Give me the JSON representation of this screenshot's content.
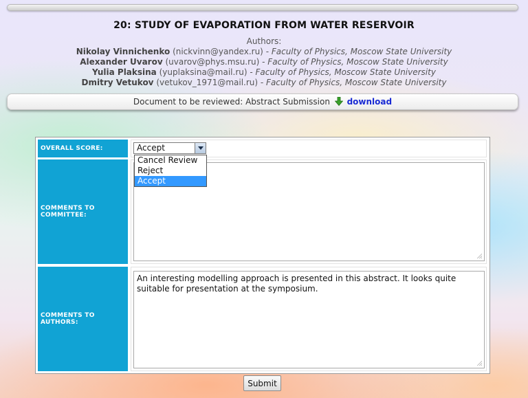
{
  "paper": {
    "title": "20: STUDY OF EVAPORATION FROM WATER RESERVOIR",
    "authors_heading": "Authors:",
    "authors": [
      {
        "name": "Nikolay Vinnichenko",
        "email": "(nickvinn@yandex.ru)",
        "separator": " - ",
        "affiliation": "Faculty of Physics, Moscow State University"
      },
      {
        "name": "Alexander Uvarov",
        "email": "(uvarov@phys.msu.ru)",
        "separator": " - ",
        "affiliation": "Faculty of Physics, Moscow State University"
      },
      {
        "name": "Yulia Plaksina",
        "email": "(yuplaksina@mail.ru)",
        "separator": " - ",
        "affiliation": "Faculty of Physics, Moscow State University"
      },
      {
        "name": "Dmitry Vetukov",
        "email": "(vetukov_1971@mail.ru)",
        "separator": " - ",
        "affiliation": "Faculty of Physics, Moscow State University"
      }
    ]
  },
  "document_bar": {
    "text": "Document to be reviewed: Abstract Submission",
    "icon": "download-arrow-icon",
    "link_label": "download"
  },
  "form": {
    "overall_score": {
      "label": "OVERALL SCORE:",
      "selected": "Accept",
      "options": [
        "Cancel Review",
        "Reject",
        "Accept"
      ],
      "dropdown_open": true
    },
    "comments_committee": {
      "label": "COMMENTS TO COMMITTEE:",
      "value": ""
    },
    "comments_authors": {
      "label": "COMMENTS TO AUTHORS:",
      "value": "An interesting modelling approach is presented in this abstract. It looks quite suitable for presentation at the symposium."
    },
    "submit_label": "Submit"
  },
  "colors": {
    "label_cell_bg": "#11a3d4",
    "link": "#1a2bd4",
    "dropdown_selected_bg": "#3399ff",
    "download_icon": "#3aa12a"
  }
}
